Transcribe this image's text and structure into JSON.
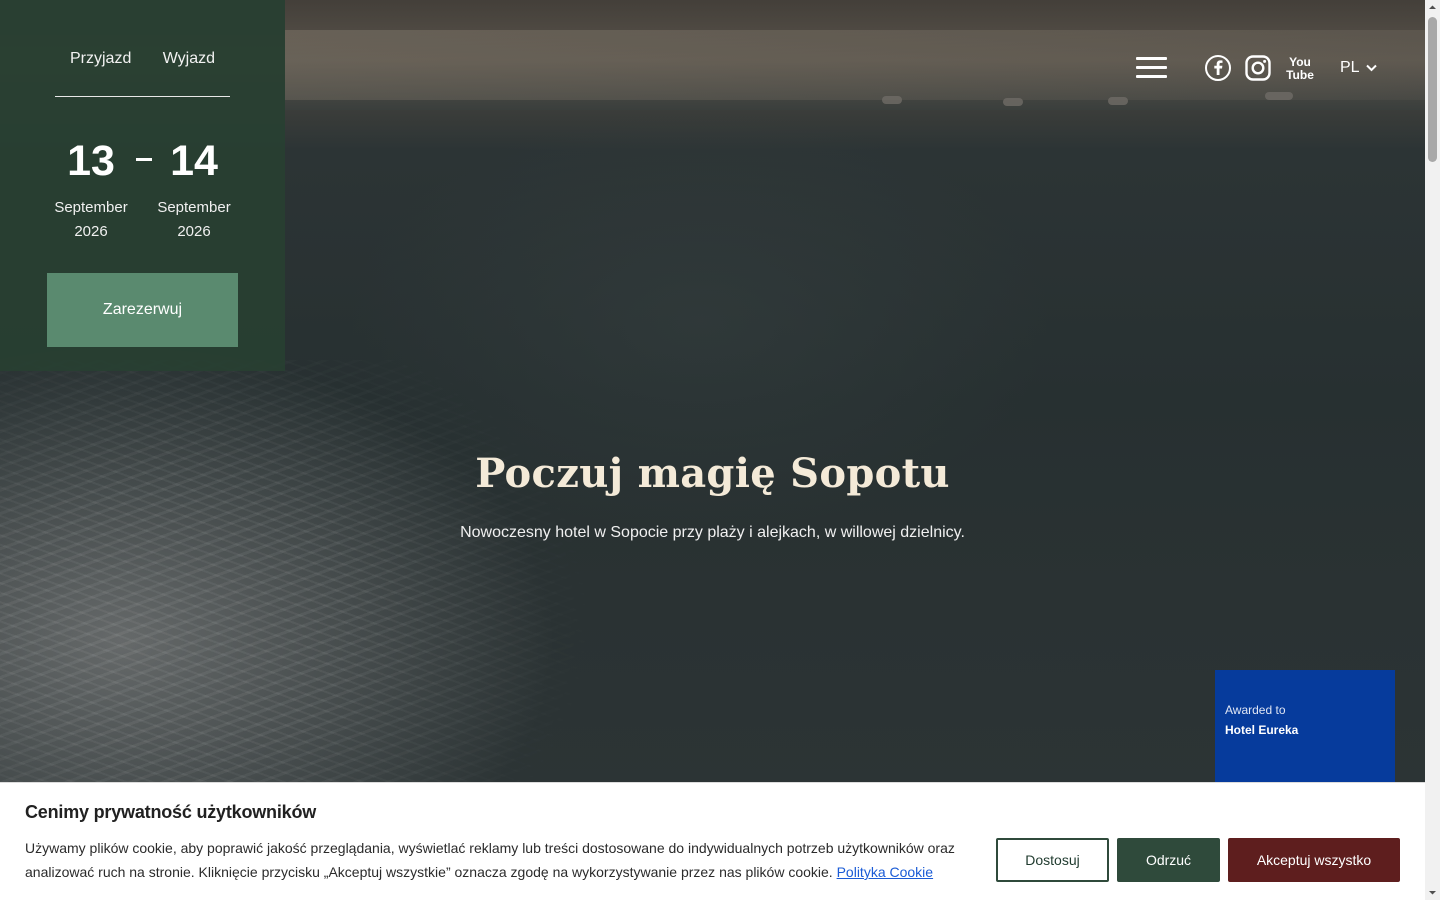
{
  "booking": {
    "arrival_label": "Przyjazd",
    "departure_label": "Wyjazd",
    "arrival": {
      "day": "13",
      "month": "September",
      "year": "2026"
    },
    "departure": {
      "day": "14",
      "month": "September",
      "year": "2026"
    },
    "reserve_label": "Zarezerwuj"
  },
  "nav": {
    "social_icons": [
      "facebook-icon",
      "instagram-icon",
      "youtube-icon"
    ],
    "language": "PL"
  },
  "hero": {
    "title": "Poczuj magię Sopotu",
    "subtitle": "Nowoczesny hotel w Sopocie przy plaży i alejkach, w willowej dzielnicy."
  },
  "award": {
    "line1": "Awarded to",
    "line2": "Hotel Eureka"
  },
  "cookie": {
    "title": "Cenimy prywatność użytkowników",
    "text": "Używamy plików cookie, aby poprawić jakość przeglądania, wyświetlać reklamy lub treści dostosowane do indywidualnych potrzeb użytkowników oraz analizować ruch na stronie. Kliknięcie przycisku „Akceptuj wszystkie” oznacza zgodę na wykorzystywanie przez nas plików cookie.",
    "policy_link": "Polityka Cookie",
    "customize_label": "Dostosuj",
    "reject_label": "Odrzuć",
    "accept_label": "Akceptuj wszystko"
  },
  "colors": {
    "panel_green": "#284032",
    "button_green": "#5a8a6f",
    "dark_green": "#2f4a3b",
    "accept_maroon": "#5e1e1e",
    "award_blue": "#063b9c",
    "title_cream": "#f4ead8"
  }
}
